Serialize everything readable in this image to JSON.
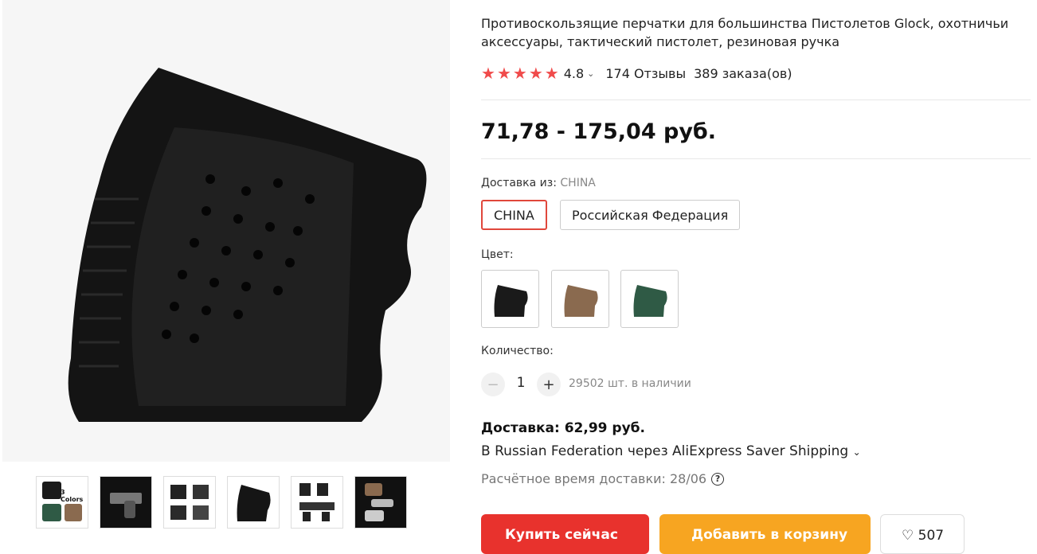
{
  "product": {
    "title": "Противоскользящие перчатки для большинства Пистолетов Glock, охотничьи аксессуары, тактический пистолет, резиновая ручка",
    "title_line1": "Противоскользящие перчатки для большинства Пистолетов Glock, охотничьи",
    "title_line2": "аксессуары, тактический пистолет, резиновая ручка",
    "rating": "4.8",
    "reviews": "174 Отзывы",
    "orders": "389 заказа(ов)",
    "price": "71,78 - 175,04 руб."
  },
  "shipping": {
    "from_label": "Доставка из:",
    "from_value": "CHINA",
    "options": [
      "CHINA",
      "Российская Федерация"
    ]
  },
  "color": {
    "label": "Цвет:",
    "swatches": [
      "black",
      "brown",
      "green"
    ]
  },
  "quantity": {
    "label": "Количество:",
    "value": "1",
    "stock": "29502 шт. в наличии",
    "minus": "−",
    "plus": "+"
  },
  "delivery": {
    "cost": "Доставка: 62,99 руб.",
    "via": "В Russian Federation через AliExpress Saver Shipping",
    "eta": "Расчётное время доставки: 28/06",
    "help_icon": "?"
  },
  "thumbs": {
    "first_label": "3 Colors"
  },
  "buttons": {
    "buy": "Купить сейчас",
    "cart": "Добавить в корзину",
    "wish": "♡ 507"
  },
  "colors": {
    "accent": "#e8322d",
    "cart": "#f7a521",
    "star": "#f04b4b",
    "swatch_black": "#1a1a1a",
    "swatch_brown": "#8a6a4f",
    "swatch_green": "#2f5a45"
  }
}
